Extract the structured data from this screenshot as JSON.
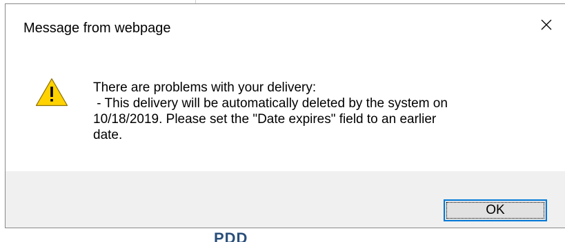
{
  "dialog": {
    "title": "Message from webpage",
    "close_icon": "close-icon",
    "warning_icon": "warning-icon",
    "message_lines": [
      "There are problems with your delivery:",
      " - This delivery will be automatically deleted by the system on",
      "10/18/2019. Please set the \"Date expires\" field to an earlier",
      "date."
    ],
    "ok_label": "OK"
  },
  "colors": {
    "footer_bg": "#f0f0f0",
    "button_border": "#0078d7",
    "warning_fill": "#ffd200"
  }
}
